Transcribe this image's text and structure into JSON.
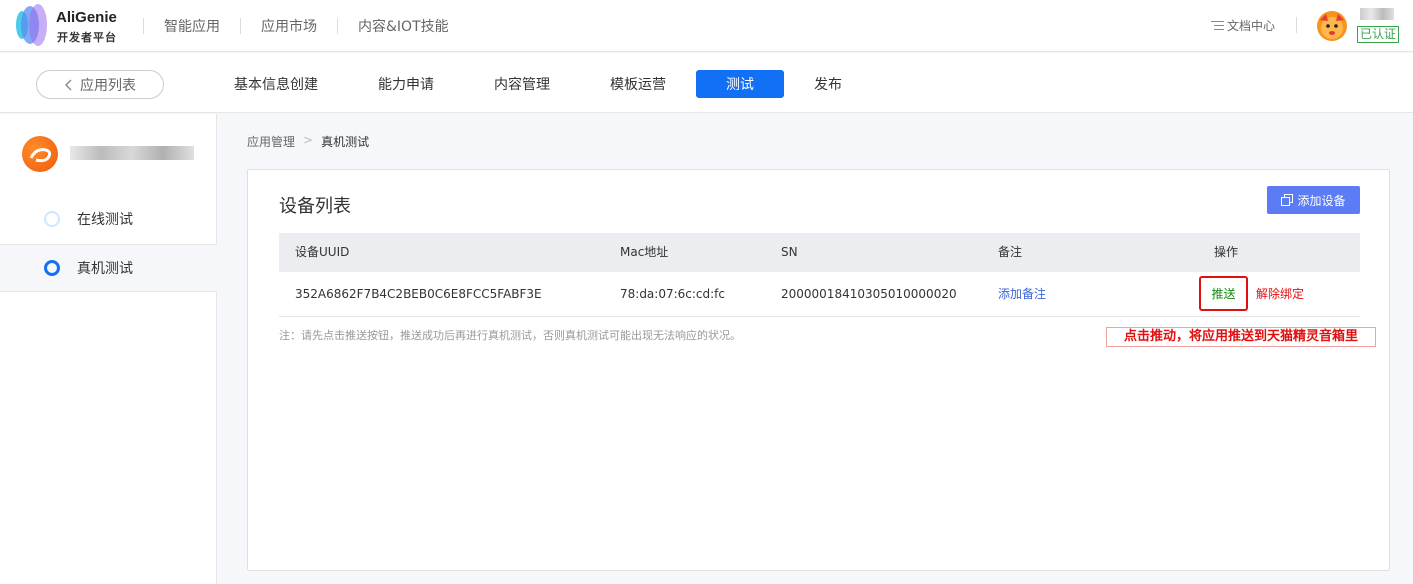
{
  "header": {
    "brand_title": "AliGenie",
    "brand_subtitle": "开发者平台",
    "nav": [
      "智能应用",
      "应用市场",
      "内容&IOT技能"
    ],
    "docs_label": "文档中心",
    "verified_label": "已认证"
  },
  "subnav": {
    "back_label": "应用列表",
    "tabs": [
      "基本信息创建",
      "能力申请",
      "内容管理",
      "模板运营",
      "测试",
      "发布"
    ],
    "active_tab": "测试"
  },
  "sidebar": {
    "items": [
      {
        "label": "在线测试",
        "active": false
      },
      {
        "label": "真机测试",
        "active": true
      }
    ]
  },
  "breadcrumb": {
    "parent": "应用管理",
    "current": "真机测试"
  },
  "devices": {
    "title": "设备列表",
    "add_button": "添加设备",
    "columns": [
      "设备UUID",
      "Mac地址",
      "SN",
      "备注",
      "操作"
    ],
    "rows": [
      {
        "uuid": "352A6862F7B4C2BEB0C6E8FCC5FABF3E",
        "mac": "78:da:07:6c:cd:fc",
        "sn": "20000018410305010000020",
        "remark_action": "添加备注",
        "push_action": "推送",
        "unbind_action": "解除绑定"
      }
    ],
    "note": "注：请先点击推送按钮，推送成功后再进行真机测试，否则真机测试可能出现无法响应的状况。",
    "callout": "点击推动，将应用推送到天猫精灵音箱里"
  },
  "colors": {
    "primary": "#1270f5",
    "add_button": "#5b7cf5",
    "danger": "#e01010",
    "push_text": "#138a13",
    "verified": "#3aa34b"
  }
}
